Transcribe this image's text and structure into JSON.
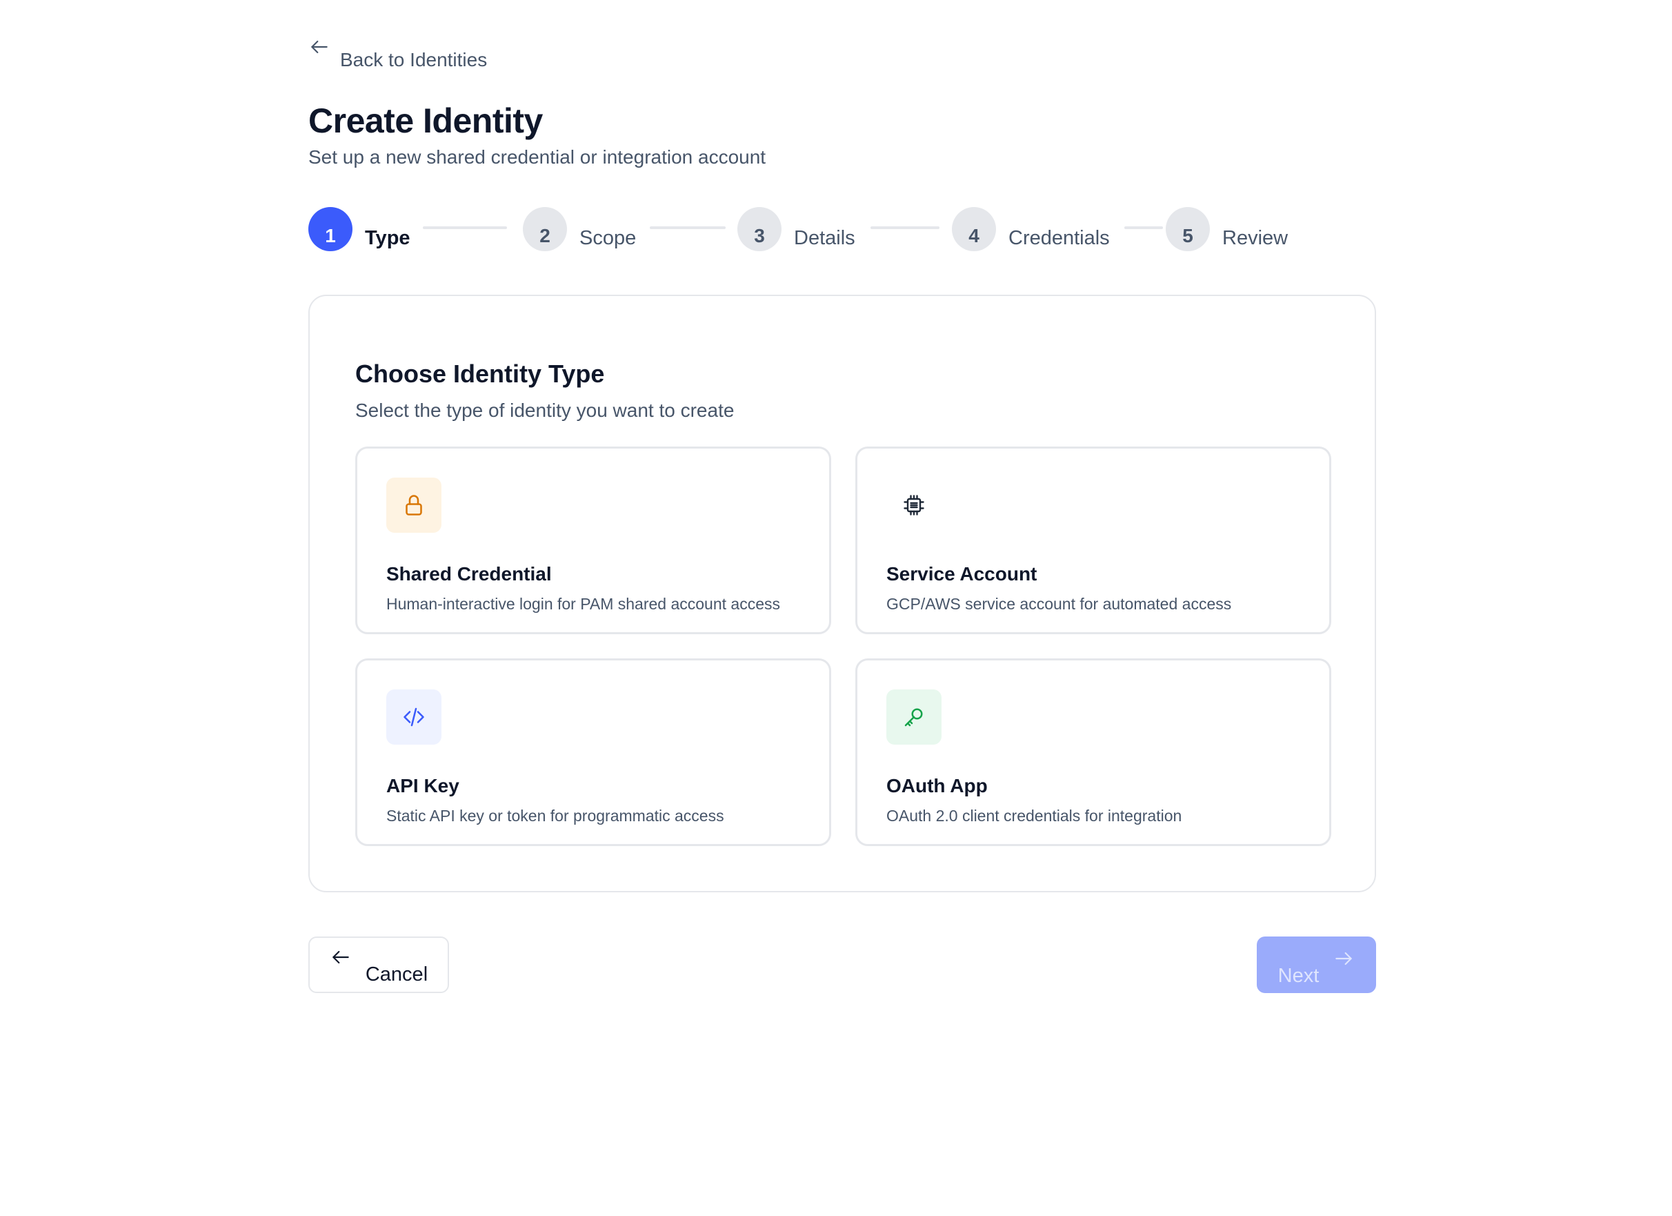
{
  "nav": {
    "back_label": "Back to Identities",
    "back_icon": "arrow-left-icon"
  },
  "header": {
    "title": "Create Identity",
    "subtitle": "Set up a new shared credential or integration account"
  },
  "stepper": {
    "active_step": 1,
    "steps": [
      {
        "number": "1",
        "label": "Type"
      },
      {
        "number": "2",
        "label": "Scope"
      },
      {
        "number": "3",
        "label": "Details"
      },
      {
        "number": "4",
        "label": "Credentials"
      },
      {
        "number": "5",
        "label": "Review"
      }
    ]
  },
  "identity_type": {
    "title": "Choose Identity Type",
    "subtitle": "Select the type of identity you want to create",
    "options": [
      {
        "title": "Shared Credential",
        "description": "Human-interactive login for PAM shared account access",
        "icon": "lock-icon",
        "icon_bg": "#fef3e2",
        "icon_color": "#d97706"
      },
      {
        "title": "Service Account",
        "description": "GCP/AWS service account for automated access",
        "icon": "chip-icon",
        "icon_bg": "#ffffff",
        "icon_color": "#1f2937"
      },
      {
        "title": "API Key",
        "description": "Static API key or token for programmatic access",
        "icon": "code-icon",
        "icon_bg": "#eef2ff",
        "icon_color": "#3b5bfb"
      },
      {
        "title": "OAuth App",
        "description": "OAuth 2.0 client credentials for integration",
        "icon": "key-icon",
        "icon_bg": "#e8f8ee",
        "icon_color": "#16a34a"
      }
    ]
  },
  "footer": {
    "cancel_label": "Cancel",
    "next_label": "Next",
    "next_disabled": true
  },
  "colors": {
    "accent": "#3b5bfb",
    "accent_disabled": "#9aabfb",
    "text_primary": "#0f172a",
    "text_secondary": "#475569",
    "border": "#e5e7eb"
  }
}
